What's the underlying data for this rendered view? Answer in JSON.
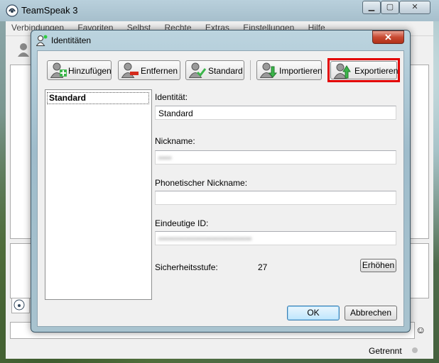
{
  "main_window": {
    "title": "TeamSpeak 3",
    "menu": [
      "Verbindungen",
      "Favoriten",
      "Selbst",
      "Rechte",
      "Extras",
      "Einstellungen",
      "Hilfe"
    ],
    "status": "Getrennt",
    "caption_buttons": {
      "minimize": "▁",
      "maximize": "▢",
      "close": "✕"
    }
  },
  "dialog": {
    "title": "Identitäten",
    "close_label": "✕",
    "toolbar": {
      "add_label": "Hinzufügen",
      "remove_label": "Entfernen",
      "standard_label": "Standard",
      "import_label": "Importieren",
      "export_label": "Exportieren"
    },
    "identities": [
      "Standard"
    ],
    "form": {
      "identity_label": "Identität:",
      "identity_value": "Standard",
      "nickname_label": "Nickname:",
      "nickname_value": "••••",
      "phonetic_label": "Phonetischer Nickname:",
      "phonetic_value": "",
      "unique_id_label": "Eindeutige ID:",
      "unique_id_value": "••••••••••••••••••••••••••••",
      "security_label": "Sicherheitsstufe:",
      "security_value": "27",
      "raise_label": "Erhöhen"
    },
    "ok_label": "OK",
    "cancel_label": "Abbrechen",
    "highlight_color": "#e30000"
  }
}
